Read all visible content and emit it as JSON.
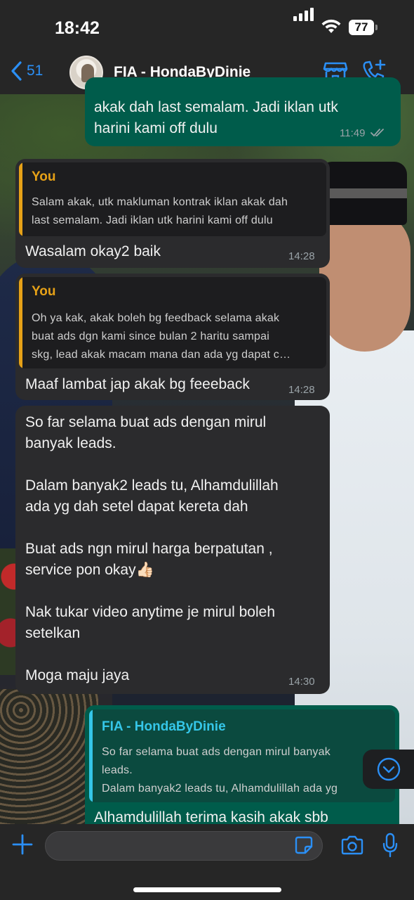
{
  "status": {
    "time": "18:42",
    "battery": "77"
  },
  "header": {
    "back_count": "51",
    "contact_name": "FIA - HondaByDinie"
  },
  "messages": [
    {
      "side": "out",
      "text": "akak dah last semalam. Jadi iklan utk\nharini kami off dulu",
      "time": "11:49"
    },
    {
      "side": "in",
      "quote_author": "You",
      "quote_text": "Salam akak, utk makluman kontrak iklan akak dah\nlast semalam. Jadi iklan utk harini kami off dulu",
      "text": "Wasalam okay2 baik",
      "time": "14:28"
    },
    {
      "side": "in",
      "quote_author": "You",
      "quote_text": "Oh ya kak, akak boleh bg feedback selama akak\nbuat ads dgn kami since bulan 2 haritu sampai\nskg, lead akak macam mana dan ada yg dapat c…",
      "text": "Maaf lambat jap akak bg feeeback",
      "time": "14:28"
    },
    {
      "side": "in",
      "text": "So far selama buat ads dengan mirul\nbanyak leads.\n\nDalam banyak2 leads tu, Alhamdulillah\nada yg dah setel dapat kereta dah\n\nBuat ads ngn mirul harga berpatutan ,\nservice pon okay👍🏻\n\nNak tukar video anytime je mirul boleh\nsetelkan\n\nMoga maju jaya",
      "time": "14:30"
    },
    {
      "side": "out",
      "quote_author": "FIA - HondaByDinie",
      "quote_text": "So far selama buat ads dengan mirul banyak\nleads.\nDalam banyak2 leads tu, Alhamdulillah ada yg",
      "text": "Alhamdulillah terima kasih akak sbb"
    }
  ],
  "colors": {
    "accent": "#2b8ff5",
    "outgoing": "#005c4b",
    "incoming": "#2b2b2d",
    "you_quote": "#e6a117",
    "contact_quote": "#35c6e8"
  }
}
